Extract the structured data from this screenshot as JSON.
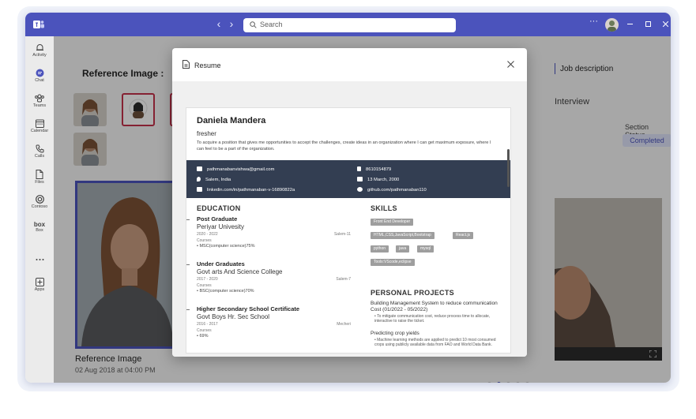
{
  "titlebar": {
    "search_placeholder": "Search",
    "more": "···"
  },
  "rail": [
    {
      "label": "Activity"
    },
    {
      "label": "Chat"
    },
    {
      "label": "Teams"
    },
    {
      "label": "Calendar"
    },
    {
      "label": "Calls"
    },
    {
      "label": "Files"
    },
    {
      "label": "Contoso"
    },
    {
      "label": "Box"
    },
    {
      "label": "Apps"
    }
  ],
  "rail_box_logo": "box",
  "main": {
    "reference_title": "Reference Image :",
    "caption": "Reference Image",
    "date": "02 Aug 2018 at 04:00 PM",
    "job_description": "Job description",
    "interview": "Interview",
    "section_status_label": "Section Status",
    "section_status_value": "Completed"
  },
  "dialog": {
    "title": "Resume",
    "resume": {
      "name": "Daniela Mandera",
      "role": "fresher",
      "objective": "To acquire a position that gives me opportunities to accept the challenges, create ideas in an organization where I can get maximum exposure, where I can feel to be a part of the organization.",
      "contact": {
        "email": "pathmanabanvishwa@gmail.com",
        "phone": "8610154879",
        "location": "Salem, India",
        "dob": "13 March, 2000",
        "linkedin": "linkedin.com/in/pathmanaban-v-16890822a",
        "github": "github.com/pathmanaban110"
      },
      "education_heading": "EDUCATION",
      "education": [
        {
          "degree": "Post Graduate",
          "institution": "Periyar Univesity",
          "years": "2020 - 2022",
          "location": "Salem-11",
          "courses_label": "Courses",
          "mark": "MSC(computer science)75%"
        },
        {
          "degree": "Under Graduates",
          "institution": "Govt arts And Science College",
          "years": "2017 - 2020",
          "location": "Salem-7",
          "courses_label": "Courses",
          "mark": "BSC(computer science)70%"
        },
        {
          "degree": "Higher Secondary School Certificate",
          "institution": "Govt Boys Hr. Sec School",
          "years": "2016 - 2017",
          "location": "Mecheri",
          "courses_label": "Courses",
          "mark": "69%"
        }
      ],
      "skills_heading": "SKILLS",
      "skills": [
        "Front End Developer",
        "HTML,CSS,JavaScript,Bootstrap",
        "React.js",
        "python",
        "java",
        "mysql",
        "Tools:VScode,eclipse"
      ],
      "projects_heading": "PERSONAL PROJECTS",
      "projects": [
        {
          "title": "Building Management System to reduce communication Cost (01/2022 - 05/2022)",
          "desc": "To mitigate communication cost, reduce process time to allocate, interactive to raise the ticket."
        },
        {
          "title": "Predicting crop yields",
          "desc": "Machine learning methods are applied to predict 10 most consumed crops using publicly available data from FAO and World Data Bank."
        }
      ]
    }
  }
}
